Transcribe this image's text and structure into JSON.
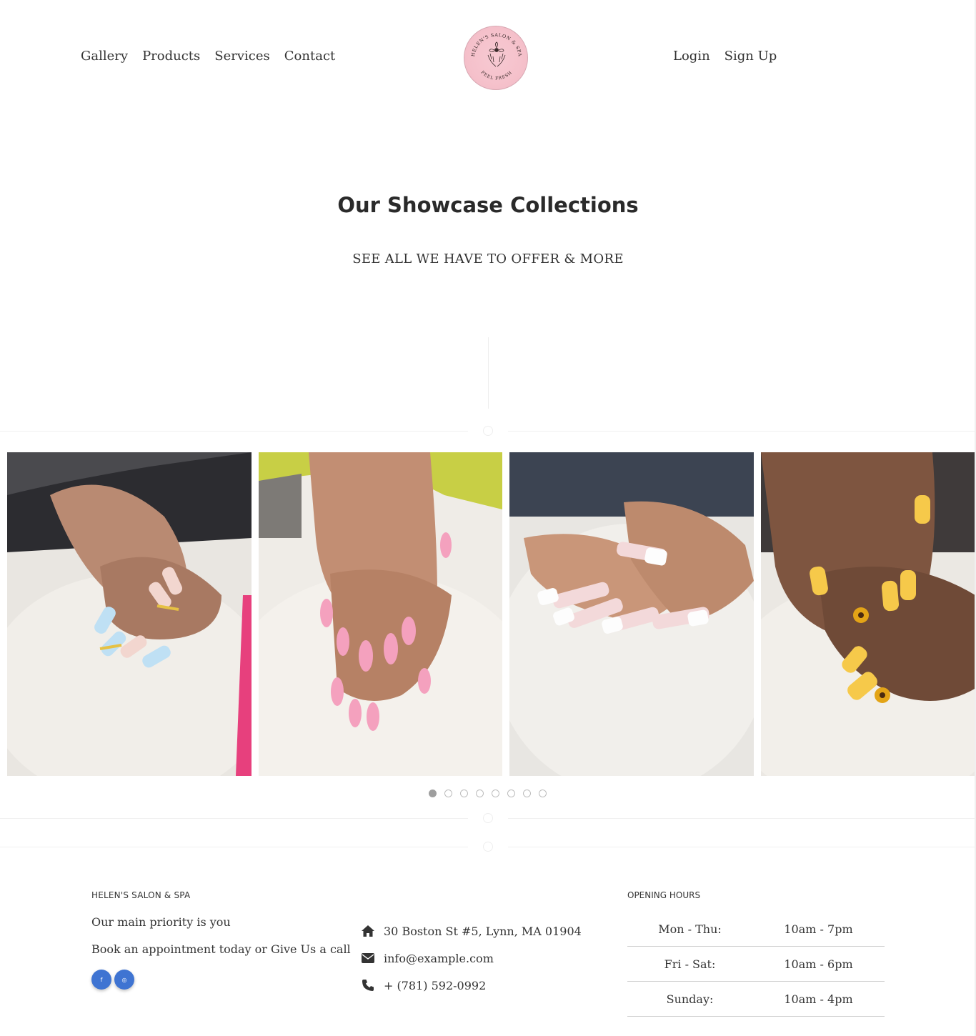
{
  "nav": {
    "left": [
      "Gallery",
      "Products",
      "Services",
      "Contact"
    ],
    "right": [
      "Login",
      "Sign Up"
    ]
  },
  "logo": {
    "top_text": "HELEN'S SALON & SPA",
    "bottom_text": "FEEL FRESH",
    "color": "#f5c1cb"
  },
  "hero": {
    "title": "Our Showcase Collections",
    "subtitle": "SEE ALL WE HAVE TO OFFER & MORE"
  },
  "gallery": {
    "photos": [
      {
        "name": "nail-photo-blue-ombre"
      },
      {
        "name": "nail-photo-pink-almond"
      },
      {
        "name": "nail-photo-white-french"
      },
      {
        "name": "nail-photo-yellow-sunflower"
      }
    ],
    "dot_count": 8,
    "active_dot": 0
  },
  "footer": {
    "brand": "HELEN'S SALON & SPA",
    "tagline": "Our main priority is you",
    "cta": "Book an appointment today or Give Us a call",
    "social": [
      {
        "icon": "facebook-icon",
        "glyph": "f"
      },
      {
        "icon": "instagram-icon",
        "glyph": "◎"
      }
    ],
    "contact": {
      "address": "30 Boston St #5, Lynn, MA 01904",
      "email": "info@example.com",
      "phone": "+ (781) 592-0992"
    },
    "hours_title": "OPENING HOURS",
    "hours": [
      {
        "day": "Mon - Thu:",
        "time": "10am - 7pm"
      },
      {
        "day": "Fri - Sat:",
        "time": "10am - 6pm"
      },
      {
        "day": "Sunday:",
        "time": "10am - 4pm"
      }
    ]
  },
  "colors": {
    "accent_blue": "#3f74d2",
    "logo_pink": "#f5c1cb"
  }
}
